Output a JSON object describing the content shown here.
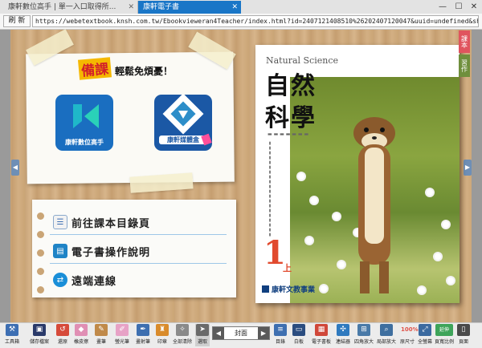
{
  "browser": {
    "tabs": [
      {
        "label": "康軒數位高手 | 單一入口取得所...",
        "active": false
      },
      {
        "label": "康軒電子書",
        "active": true
      }
    ],
    "refresh_label": "刷 新",
    "url": "https://webetextbook.knsh.com.tw/Ebookvieweran4Teacher/index.html?id=2407121408510%26202407120047&uuid=undefined&short",
    "window_controls": {
      "minimize": "—",
      "maximize": "☐",
      "close": "✕"
    }
  },
  "left_panel": {
    "slogan_highlight": "備課",
    "slogan_rest": "輕鬆免煩憂！",
    "apps": [
      {
        "label": "康軒數位高手"
      },
      {
        "label": "康軒媒體盒"
      }
    ],
    "menu": [
      {
        "label": "前往課本目錄頁",
        "icon": "list-icon"
      },
      {
        "label": "電子書操作說明",
        "icon": "notebook-icon"
      },
      {
        "label": "遠端連線",
        "icon": "remote-connect-icon"
      }
    ]
  },
  "book_cover": {
    "subject_en": "Natural Science",
    "title_line1": "自然",
    "title_line2": "科學",
    "grade_number": "1",
    "grade_suffix": "上",
    "publisher": "康軒文教事業"
  },
  "side_tabs": [
    {
      "label": "課本",
      "color": "#e0545e"
    },
    {
      "label": "習作",
      "color": "#6f8f3d"
    }
  ],
  "toolbar": {
    "tools": [
      {
        "label": "工具箱",
        "color": "#3d6fb3"
      },
      {
        "label": "儲存檔案",
        "color": "#2a3a6a"
      },
      {
        "label": "還原",
        "color": "#d64a3a"
      },
      {
        "label": "橡皮擦",
        "color": "#e08fb4"
      },
      {
        "label": "畫筆",
        "color": "#c08a4a"
      },
      {
        "label": "螢光筆",
        "color": "#e7a2c6"
      },
      {
        "label": "畫射筆",
        "color": "#3e6fb0"
      },
      {
        "label": "印章",
        "color": "#d98b2b"
      },
      {
        "label": "全部清除",
        "color": "#8a8a8a"
      },
      {
        "label": "選取",
        "color": "#6a6a6a"
      }
    ],
    "page_value": "封面",
    "right_tools": [
      {
        "label": "目錄",
        "color": "#3e6fb0"
      },
      {
        "label": "白板",
        "color": "#2b4d80"
      },
      {
        "label": "電子書板",
        "color": "#d0483a"
      },
      {
        "label": "連結器",
        "color": "#2f7abf"
      },
      {
        "label": "四角放大",
        "color": "#4a7aa8"
      },
      {
        "label": "局部放大",
        "color": "#3f6f9f"
      },
      {
        "label": "原尺寸",
        "color": "#e0544a"
      },
      {
        "label": "全螢幕",
        "color": "#3b6aa0"
      },
      {
        "label": "頁寬比例",
        "color": "#3ea45a"
      },
      {
        "label": "頁面",
        "color": "#4a4a4a"
      }
    ],
    "page_mode_label": "100%",
    "tool_extra_label": "延伸"
  }
}
